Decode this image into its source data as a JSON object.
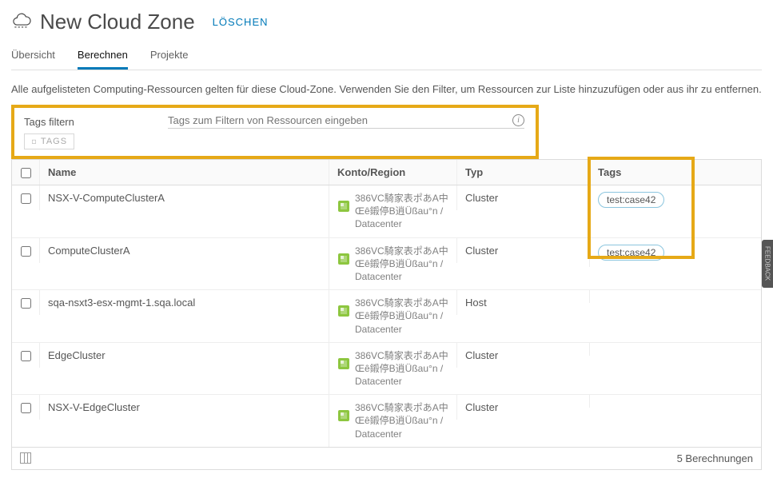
{
  "header": {
    "title": "New Cloud Zone",
    "delete_label": "LÖSCHEN"
  },
  "tabs": [
    {
      "label": "Übersicht",
      "active": false
    },
    {
      "label": "Berechnen",
      "active": true
    },
    {
      "label": "Projekte",
      "active": false
    }
  ],
  "description": "Alle aufgelisteten Computing-Ressourcen gelten für diese Cloud-Zone. Verwenden Sie den Filter, um Ressourcen zur Liste hinzuzufügen oder aus ihr zu entfernen.",
  "filter": {
    "label": "Tags filtern",
    "placeholder": "Tags zum Filtern von Ressourcen eingeben",
    "value": "",
    "tags_button": "TAGS"
  },
  "columns": {
    "name": "Name",
    "account": "Konto/Region",
    "type": "Typ",
    "tags": "Tags"
  },
  "rows": [
    {
      "name": "NSX-V-ComputeClusterA",
      "account": "386VC騎家表ポあA中Œê鎩停B逍Üßau°n / Datacenter",
      "type": "Cluster",
      "tags": [
        "test:case42"
      ]
    },
    {
      "name": "ComputeClusterA",
      "account": "386VC騎家表ポあA中Œê鎩停B逍Üßau°n / Datacenter",
      "type": "Cluster",
      "tags": [
        "test:case42"
      ]
    },
    {
      "name": "sqa-nsxt3-esx-mgmt-1.sqa.local",
      "account": "386VC騎家表ポあA中Œê鎩停B逍Üßau°n / Datacenter",
      "type": "Host",
      "tags": []
    },
    {
      "name": "EdgeCluster",
      "account": "386VC騎家表ポあA中Œê鎩停B逍Üßau°n / Datacenter",
      "type": "Cluster",
      "tags": []
    },
    {
      "name": "NSX-V-EdgeCluster",
      "account": "386VC騎家表ポあA中Œê鎩停B逍Üßau°n / Datacenter",
      "type": "Cluster",
      "tags": []
    }
  ],
  "footer": {
    "count_label": "5 Berechnungen"
  },
  "feedback_label": "FEEDBACK"
}
